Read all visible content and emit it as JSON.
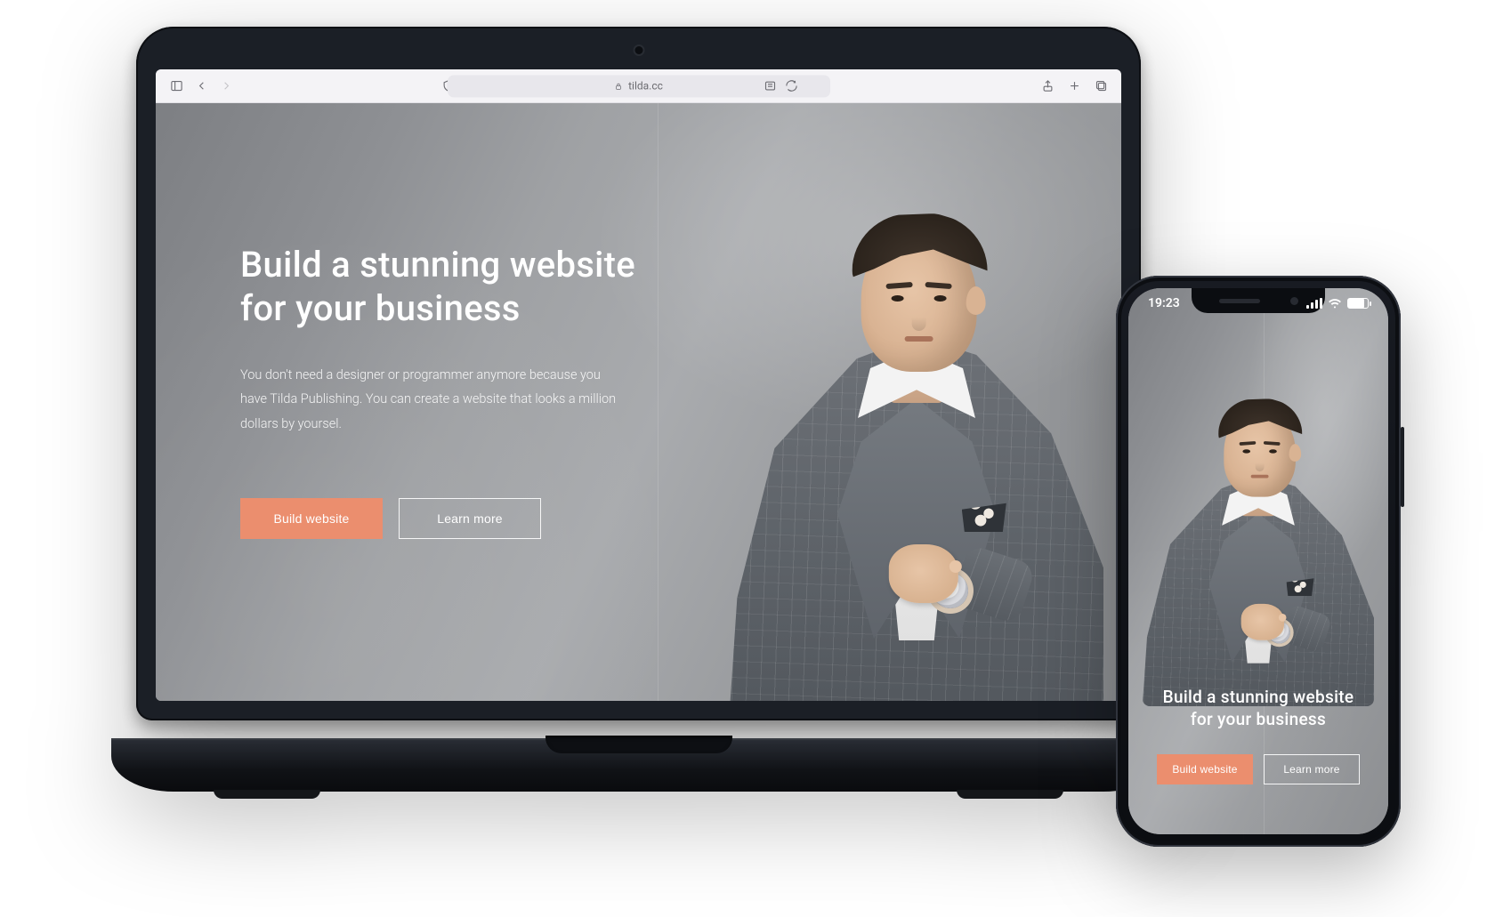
{
  "browser": {
    "url_host": "tilda.cc",
    "icons": {
      "sidebar": "sidebar-icon",
      "back": "chevron-left-icon",
      "forward": "chevron-right-icon",
      "privacy": "shield-half-icon",
      "lock": "lock-icon",
      "reader": "reader-icon",
      "refresh": "refresh-icon",
      "share": "share-icon",
      "newtab": "plus-icon",
      "tabs": "tabs-icon"
    }
  },
  "hero": {
    "title_line1": "Build a stunning website",
    "title_line2": "for your business",
    "subtitle": "You don't need a designer or programmer anymore because you have Tilda Publishing. You can create a website that looks a million dollars by yoursel.",
    "cta_primary": "Build website",
    "cta_secondary": "Learn more"
  },
  "phone": {
    "status_time": "19:23",
    "hero_title": "Build a stunning website\nfor your business",
    "cta_primary": "Build website",
    "cta_secondary": "Learn more"
  },
  "colors": {
    "accent": "#eb8e6e"
  }
}
